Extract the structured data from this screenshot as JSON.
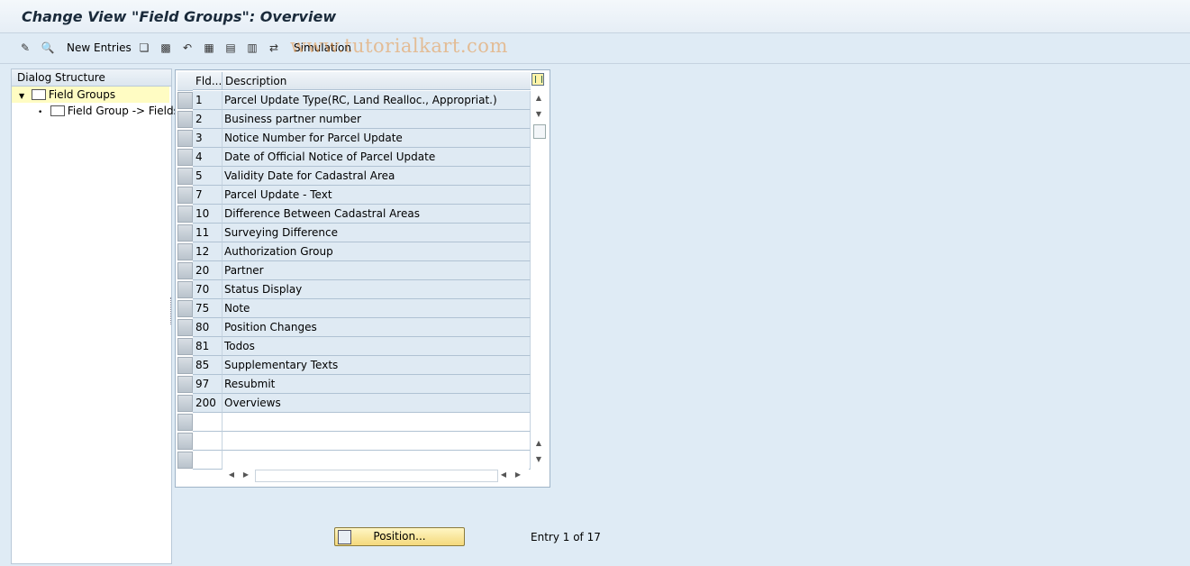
{
  "window": {
    "title": "Change View \"Field Groups\": Overview"
  },
  "toolbar": {
    "new_entries_label": "New Entries",
    "simulation_label": "Simulation",
    "watermark": "www.tutorialkart.com"
  },
  "dialog_structure": {
    "header": "Dialog Structure",
    "items": [
      {
        "label": "Field Groups",
        "selected": true,
        "expanded": true
      },
      {
        "label": "Field Group -> Fields",
        "selected": false
      }
    ]
  },
  "table": {
    "columns": [
      "Fld...",
      "Description"
    ],
    "rows": [
      {
        "fld": "1",
        "description": "Parcel Update Type(RC, Land Realloc., Appropriat.)"
      },
      {
        "fld": "2",
        "description": "Business partner number"
      },
      {
        "fld": "3",
        "description": "Notice Number for Parcel Update"
      },
      {
        "fld": "4",
        "description": "Date of Official Notice of Parcel Update"
      },
      {
        "fld": "5",
        "description": "Validity Date for Cadastral Area"
      },
      {
        "fld": "7",
        "description": "Parcel Update - Text"
      },
      {
        "fld": "10",
        "description": "Difference Between Cadastral Areas"
      },
      {
        "fld": "11",
        "description": "Surveying Difference"
      },
      {
        "fld": "12",
        "description": "Authorization Group"
      },
      {
        "fld": "20",
        "description": "Partner"
      },
      {
        "fld": "70",
        "description": "Status Display"
      },
      {
        "fld": "75",
        "description": "Note"
      },
      {
        "fld": "80",
        "description": "Position Changes"
      },
      {
        "fld": "81",
        "description": "Todos"
      },
      {
        "fld": "85",
        "description": "Supplementary Texts"
      },
      {
        "fld": "97",
        "description": "Resubmit"
      },
      {
        "fld": "200",
        "description": "Overviews"
      }
    ],
    "empty_rows": 3
  },
  "footer": {
    "position_button": "Position...",
    "entry_text": "Entry 1 of 17"
  }
}
